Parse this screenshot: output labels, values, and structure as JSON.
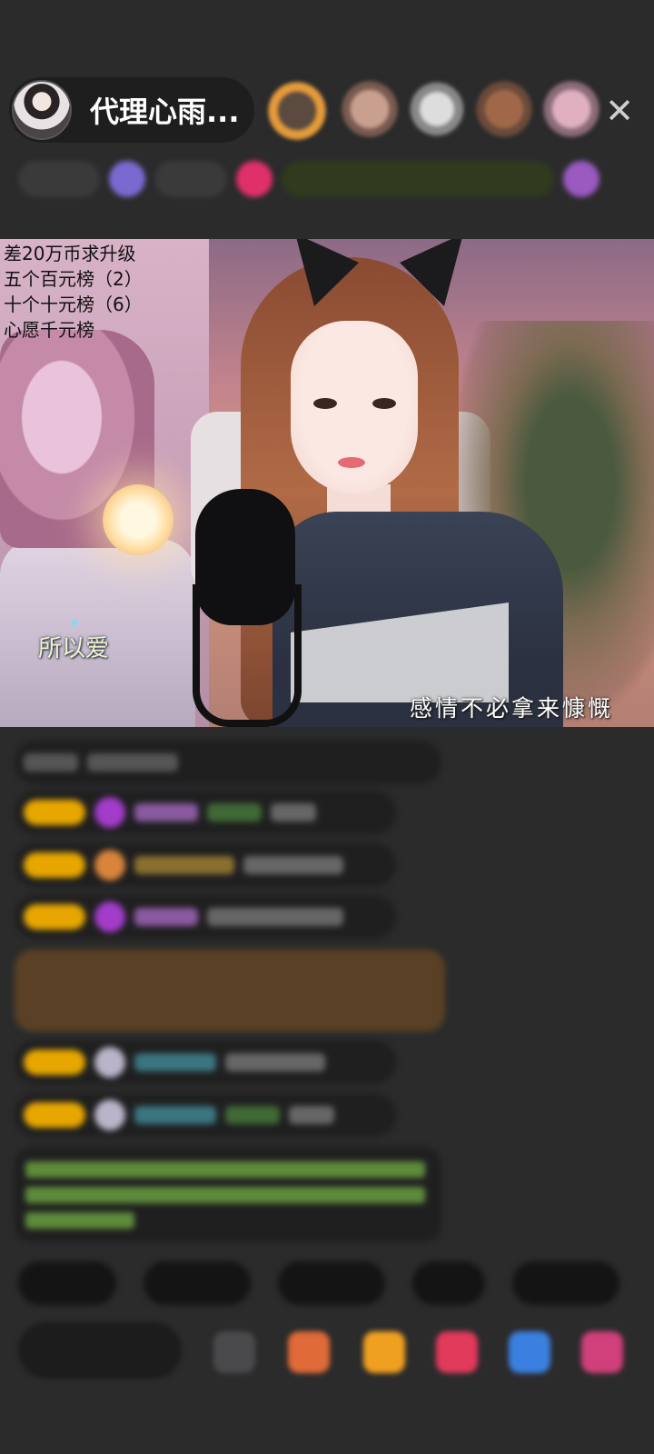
{
  "header": {
    "host_name": "代理心雨...",
    "close_icon": "✕"
  },
  "video": {
    "wish_list": [
      "差20万币求升级",
      "五个百元榜（2）",
      "十个十元榜（6）",
      "心愿千元榜"
    ],
    "lyric_left": "所以爱",
    "lyric_right": "感情不必拿来慷慨",
    "star_icon": "★"
  },
  "colors": {
    "background": "#2b2b2c",
    "badge_gold": "#e7a700",
    "highlight_brown": "#5a4125",
    "notice_green": "#5e8b3b"
  }
}
